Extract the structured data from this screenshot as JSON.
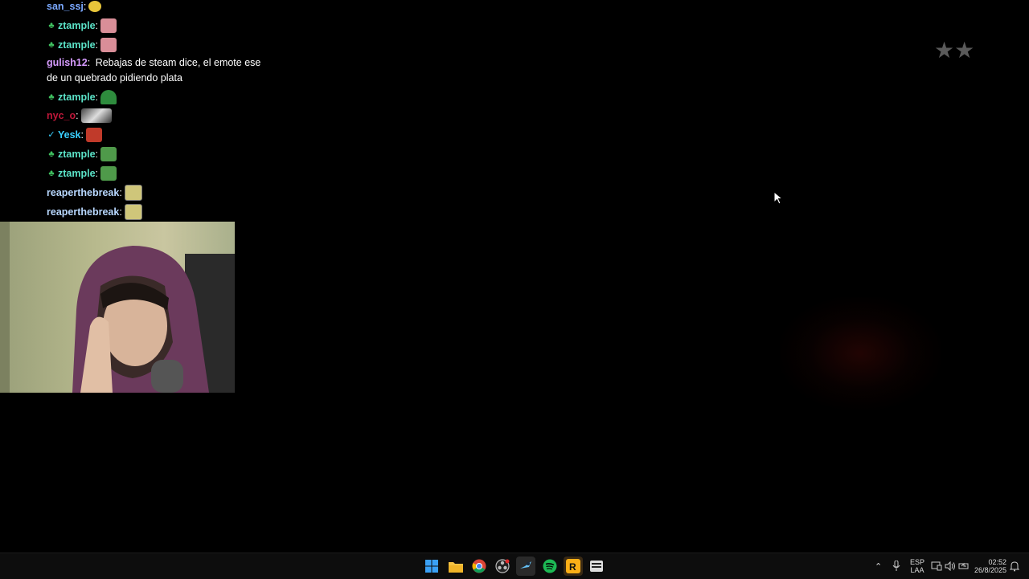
{
  "chat": {
    "messages": [
      {
        "user": "san_ssj",
        "color": "#7aa8ff",
        "sep": ":",
        "text": "",
        "emote": "emote-doge",
        "badge": ""
      },
      {
        "user": "ztample",
        "color": "#5be3c8",
        "sep": ":",
        "text": "",
        "emote": "emote-pink",
        "badge": "♣"
      },
      {
        "user": "ztample",
        "color": "#5be3c8",
        "sep": ":",
        "text": "",
        "emote": "emote-pink",
        "badge": "♣"
      },
      {
        "user": "gulish12",
        "color": "#d79cff",
        "sep": ":",
        "text": "Rebajas de steam dice, el emote ese de un quebrado pidiendo plata",
        "emote": "",
        "badge": ""
      },
      {
        "user": "ztample",
        "color": "#5be3c8",
        "sep": ":",
        "text": "",
        "emote": "emote-green",
        "badge": "♣"
      },
      {
        "user": "nyc_o",
        "color": "#c0183a",
        "sep": ":",
        "text": "",
        "emote": "emote-photo",
        "badge": ""
      },
      {
        "user": "Yesk",
        "color": "#3ad0ff",
        "sep": ":",
        "text": "",
        "emote": "emote-red",
        "badge": "✓"
      },
      {
        "user": "ztample",
        "color": "#5be3c8",
        "sep": ":",
        "text": "",
        "emote": "emote-pepe",
        "badge": "♣"
      },
      {
        "user": "ztample",
        "color": "#5be3c8",
        "sep": ":",
        "text": "",
        "emote": "emote-pepe",
        "badge": "♣"
      },
      {
        "user": "reaperthebreak",
        "color": "#b8d8ff",
        "sep": ":",
        "text": "",
        "emote": "emote-eyes",
        "badge": ""
      },
      {
        "user": "reaperthebreak",
        "color": "#b8d8ff",
        "sep": ":",
        "text": "",
        "emote": "emote-eyes",
        "badge": ""
      }
    ]
  },
  "overlay": {
    "stars": "★★"
  },
  "taskbar": {
    "apps": [
      "windows-start-icon",
      "file-explorer-icon",
      "chrome-icon",
      "obs-icon",
      "steam-icon",
      "spotify-icon",
      "rockstar-icon",
      "app-icon"
    ],
    "language_line1": "ESP",
    "language_line2": "LAA",
    "time": "02:52",
    "date": "26/8/2025"
  }
}
